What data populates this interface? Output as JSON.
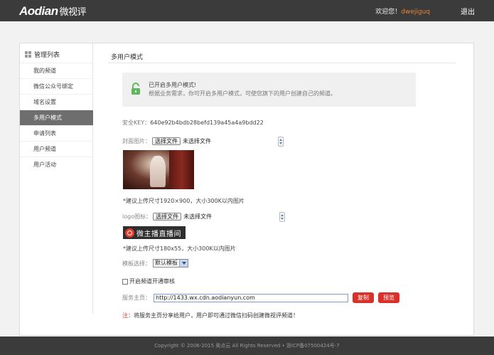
{
  "header": {
    "logo_en": "Aodian",
    "logo_cn": "微视评",
    "welcome": "欢迎您！",
    "username": "dwejiguq",
    "logout": "退出"
  },
  "sidebar": {
    "title": "管理列表",
    "items": [
      {
        "label": "我的频道"
      },
      {
        "label": "微信公众号绑定"
      },
      {
        "label": "域名设置"
      },
      {
        "label": "多用户模式",
        "active": true
      },
      {
        "label": "申请列表"
      },
      {
        "label": "用户频道"
      },
      {
        "label": "用户活动"
      }
    ]
  },
  "main": {
    "title": "多用户模式",
    "notice": {
      "title": "已开启多用户模式!",
      "desc": "根据业务需求，你可开启多用户模式，可使您旗下的用户创建自己的频道。"
    },
    "key_label": "安全KEY：",
    "key_value": "640e92b4bdb28befd139a45a4a9bdd22",
    "cover": {
      "label": "封面图片：",
      "button": "选择文件",
      "status": "未选择文件",
      "hint": "*建议上传尺寸1920×900，大小300K以内图片"
    },
    "logo": {
      "label": "logo图标：",
      "button": "选择文件",
      "status": "未选择文件",
      "image_text": "微主播直播间",
      "hint": "*建议上传尺寸180x55，大小300K以内图片"
    },
    "template": {
      "label": "模板选择：",
      "selected": "默认模板"
    },
    "audit": {
      "label": "开启频道开通审核",
      "checked": false
    },
    "service": {
      "label": "服务主页：",
      "value": "http://1433.wx.cdn.aodianyun.com",
      "copy": "复制",
      "preview": "预览"
    },
    "note": {
      "mark": "注：",
      "text": "将服务主页分享给用户，用户即可通过微信扫码创建微视评频道！"
    }
  },
  "footer": {
    "text": "Copyright © 2006-2015 奥点云 All Rights Reserved • 浙ICP备07500424号-7"
  },
  "colors": {
    "topbar": "#3b3b3b",
    "active_item": "#6e6e6e",
    "accent_red": "#d9302a",
    "username": "#e8833a",
    "lock_green": "#5cb85c"
  }
}
